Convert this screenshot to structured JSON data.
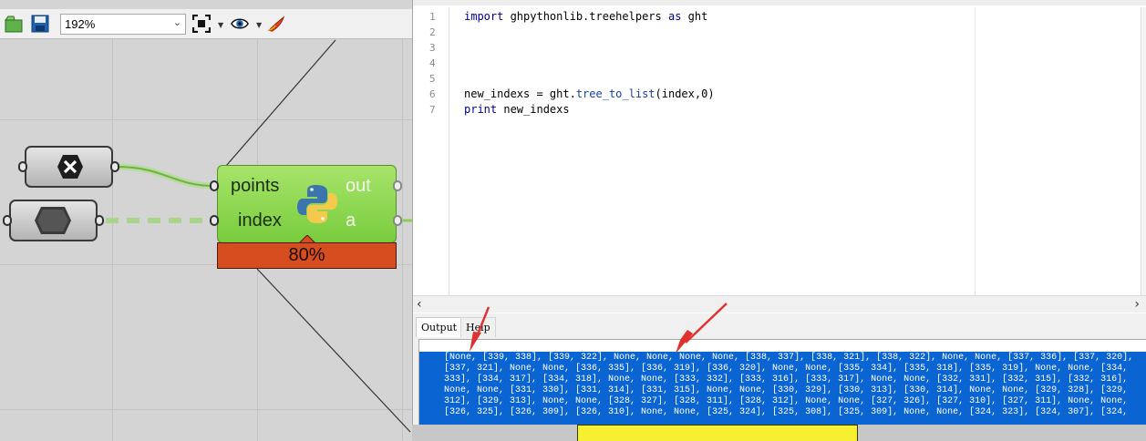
{
  "toolbar": {
    "zoom_value": "192%",
    "icons": [
      "open-file-icon",
      "save-icon",
      "zoom-extents-icon",
      "preview-eye-icon",
      "sketch-pen-icon"
    ]
  },
  "canvas": {
    "python_component": {
      "inputs": [
        "points",
        "index"
      ],
      "outputs": [
        "out",
        "a"
      ],
      "progress_label": "80%"
    }
  },
  "editor": {
    "line_numbers": [
      "1",
      "2",
      "3",
      "4",
      "5",
      "6",
      "7"
    ],
    "lines": {
      "l1_kw": "import",
      "l1_mod": " ghpythonlib.treehelpers ",
      "l1_as": "as",
      "l1_alias": " ght",
      "l6_a": "new_indexs = ght.",
      "l6_fn": "tree_to_list",
      "l6_b": "(index,0)",
      "l7_kw": "print",
      "l7_rest": " new_indexs"
    }
  },
  "output": {
    "tabs": [
      "Output",
      "Help"
    ],
    "text_lines": [
      "[None, [339, 338], [339, 322], None, None, None, None, [338, 337], [338, 321], [338, 322], None, None, [337, 336], [337, 320],",
      "[337, 321], None, None, [336, 335], [336, 319], [336, 320], None, None, [335, 334], [335, 318], [335, 319], None, None, [334,",
      "333], [334, 317], [334, 318], None, None, [333, 332], [333, 316], [333, 317], None, None, [332, 331], [332, 315], [332, 316],",
      "None, None, [331, 330], [331, 314], [331, 315], None, None, [330, 329], [330, 313], [330, 314], None, None, [329, 328], [329,",
      "312], [329, 313], None, None, [328, 327], [328, 311], [328, 312], None, None, [327, 326], [327, 310], [327, 311], None, None,",
      "[326, 325], [326, 309], [326, 310], None, None, [325, 324], [325, 308], [325, 309], None, None, [324, 323], [324, 307], [324,"
    ]
  },
  "colors": {
    "component_green": "#79cc3e",
    "progress_orange": "#d64d1f",
    "selection_blue": "#0a64d2",
    "annotation_red": "#e03030",
    "yellow_block": "#f7f032"
  }
}
